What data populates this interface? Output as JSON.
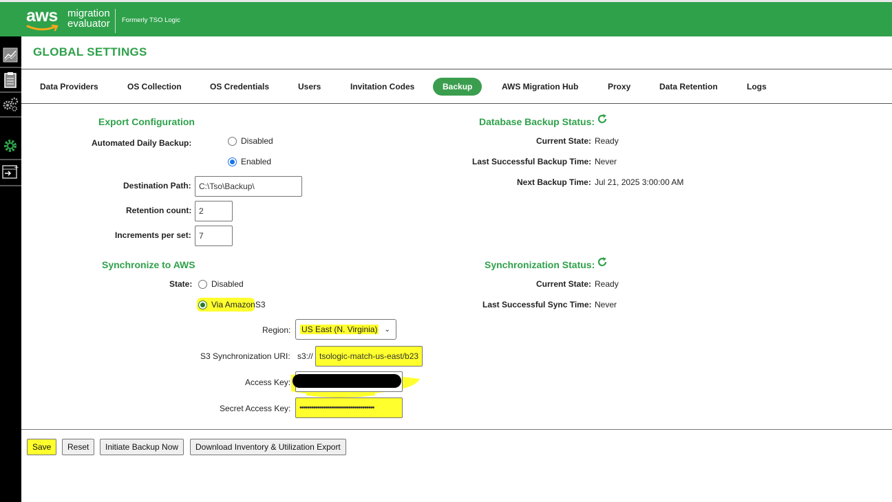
{
  "header": {
    "logo_aws": "aws",
    "logo_product_line1": "migration",
    "logo_product_line2": "evaluator",
    "formerly": "Formerly TSO Logic",
    "color": "#2fa14b"
  },
  "sidebar": {
    "icons": [
      "chart-icon",
      "clipboard-icon",
      "gears-icon",
      "settings-gear-icon",
      "export-window-icon"
    ]
  },
  "page": {
    "title": "GLOBAL SETTINGS"
  },
  "tabs": [
    {
      "label": "Data Providers"
    },
    {
      "label": "OS Collection"
    },
    {
      "label": "OS Credentials"
    },
    {
      "label": "Users"
    },
    {
      "label": "Invitation Codes"
    },
    {
      "label": "Backup",
      "active": true
    },
    {
      "label": "AWS Migration Hub"
    },
    {
      "label": "Proxy"
    },
    {
      "label": "Data Retention"
    },
    {
      "label": "Logs"
    }
  ],
  "export_config": {
    "heading": "Export Configuration",
    "auto_backup_label": "Automated Daily Backup:",
    "option_disabled": "Disabled",
    "option_enabled": "Enabled",
    "selected": "Enabled",
    "destination_label": "Destination Path:",
    "destination_value": "C:\\Tso\\Backup\\",
    "retention_label": "Retention count:",
    "retention_value": "2",
    "increments_label": "Increments per set:",
    "increments_value": "7"
  },
  "db_status": {
    "heading": "Database Backup Status:",
    "current_state_label": "Current State:",
    "current_state_value": "Ready",
    "last_backup_label": "Last Successful Backup Time:",
    "last_backup_value": "Never",
    "next_backup_label": "Next Backup Time:",
    "next_backup_value": "Jul 21, 2025 3:00:00 AM"
  },
  "sync": {
    "heading": "Synchronize to AWS",
    "state_label": "State:",
    "option_disabled": "Disabled",
    "option_s3_part1": "Via Amazon",
    "option_s3_part2": " S3",
    "selected": "Via Amazon S3",
    "region_label": "Region:",
    "region_value": "US East (N. Virginia)",
    "uri_label": "S3 Synchronization URI:",
    "uri_prefix": "s3://",
    "uri_value": "tsologic-match-us-east/b23",
    "access_key_label": "Access Key:",
    "secret_key_label": "Secret Access Key:",
    "secret_key_value": "••••••••••••••••••••••••••••••••••••••"
  },
  "sync_status": {
    "heading": "Synchronization Status:",
    "current_state_label": "Current State:",
    "current_state_value": "Ready",
    "last_sync_label": "Last Successful Sync Time:",
    "last_sync_value": "Never"
  },
  "buttons": {
    "save": "Save",
    "reset": "Reset",
    "initiate": "Initiate Backup Now",
    "download": "Download Inventory & Utilization Export"
  },
  "colors": {
    "accent": "#2fa14b",
    "highlight": "#ffff2e",
    "sidebar": "#000000"
  }
}
